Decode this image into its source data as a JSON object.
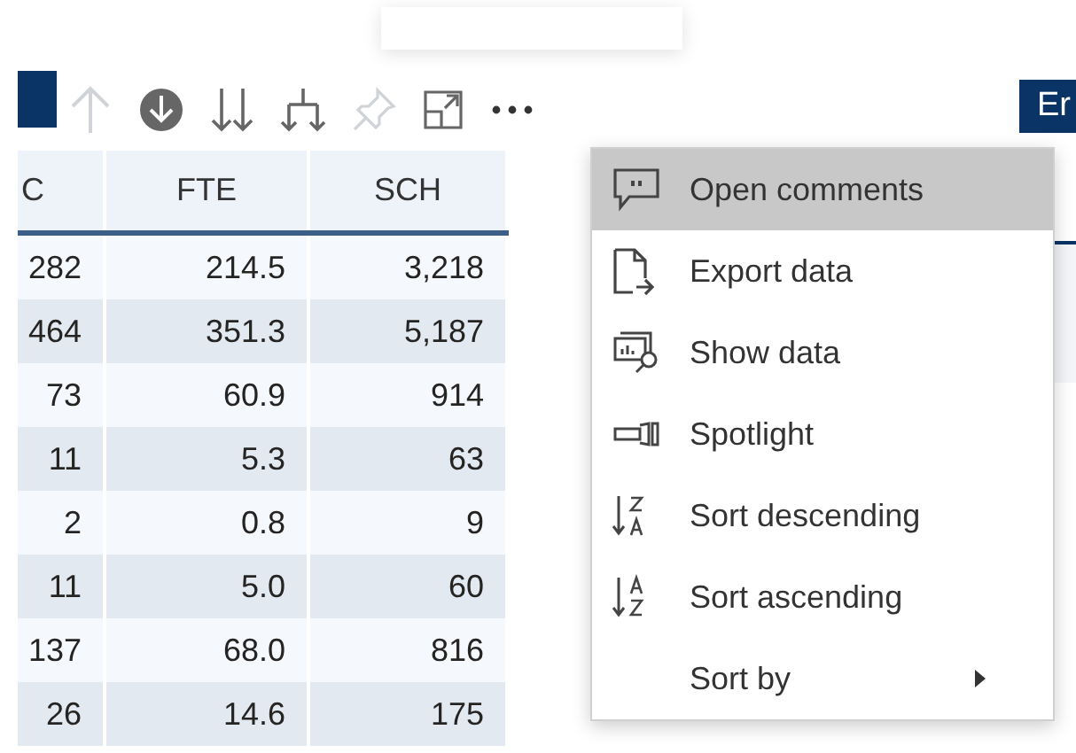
{
  "toolbar": {
    "items": [
      {
        "kind": "up",
        "disabled": true
      },
      {
        "kind": "down-circle",
        "disabled": false
      },
      {
        "kind": "double-down",
        "disabled": false
      },
      {
        "kind": "expand-down",
        "disabled": false
      },
      {
        "kind": "pin",
        "disabled": true
      },
      {
        "kind": "focus",
        "disabled": false
      },
      {
        "kind": "more",
        "disabled": false
      }
    ]
  },
  "table": {
    "columns": [
      "C",
      "FTE",
      "SCH"
    ],
    "rows": [
      [
        "282",
        "214.5",
        "3,218"
      ],
      [
        "464",
        "351.3",
        "5,187"
      ],
      [
        "73",
        "60.9",
        "914"
      ],
      [
        "11",
        "5.3",
        "63"
      ],
      [
        "2",
        "0.8",
        "9"
      ],
      [
        "11",
        "5.0",
        "60"
      ],
      [
        "137",
        "68.0",
        "816"
      ],
      [
        "26",
        "14.6",
        "175"
      ]
    ]
  },
  "next_visual": {
    "title": "Er"
  },
  "context_menu": {
    "items": [
      {
        "kind": "comment",
        "label": "Open comments",
        "selected": true,
        "submenu": false
      },
      {
        "kind": "export",
        "label": "Export data",
        "selected": false,
        "submenu": false
      },
      {
        "kind": "show",
        "label": "Show data",
        "selected": false,
        "submenu": false
      },
      {
        "kind": "spotlight",
        "label": "Spotlight",
        "selected": false,
        "submenu": false
      },
      {
        "kind": "sort-desc",
        "label": "Sort descending",
        "selected": false,
        "submenu": false
      },
      {
        "kind": "sort-asc",
        "label": "Sort ascending",
        "selected": false,
        "submenu": false
      },
      {
        "kind": "submenu",
        "label": "Sort by",
        "selected": false,
        "submenu": true
      }
    ]
  }
}
